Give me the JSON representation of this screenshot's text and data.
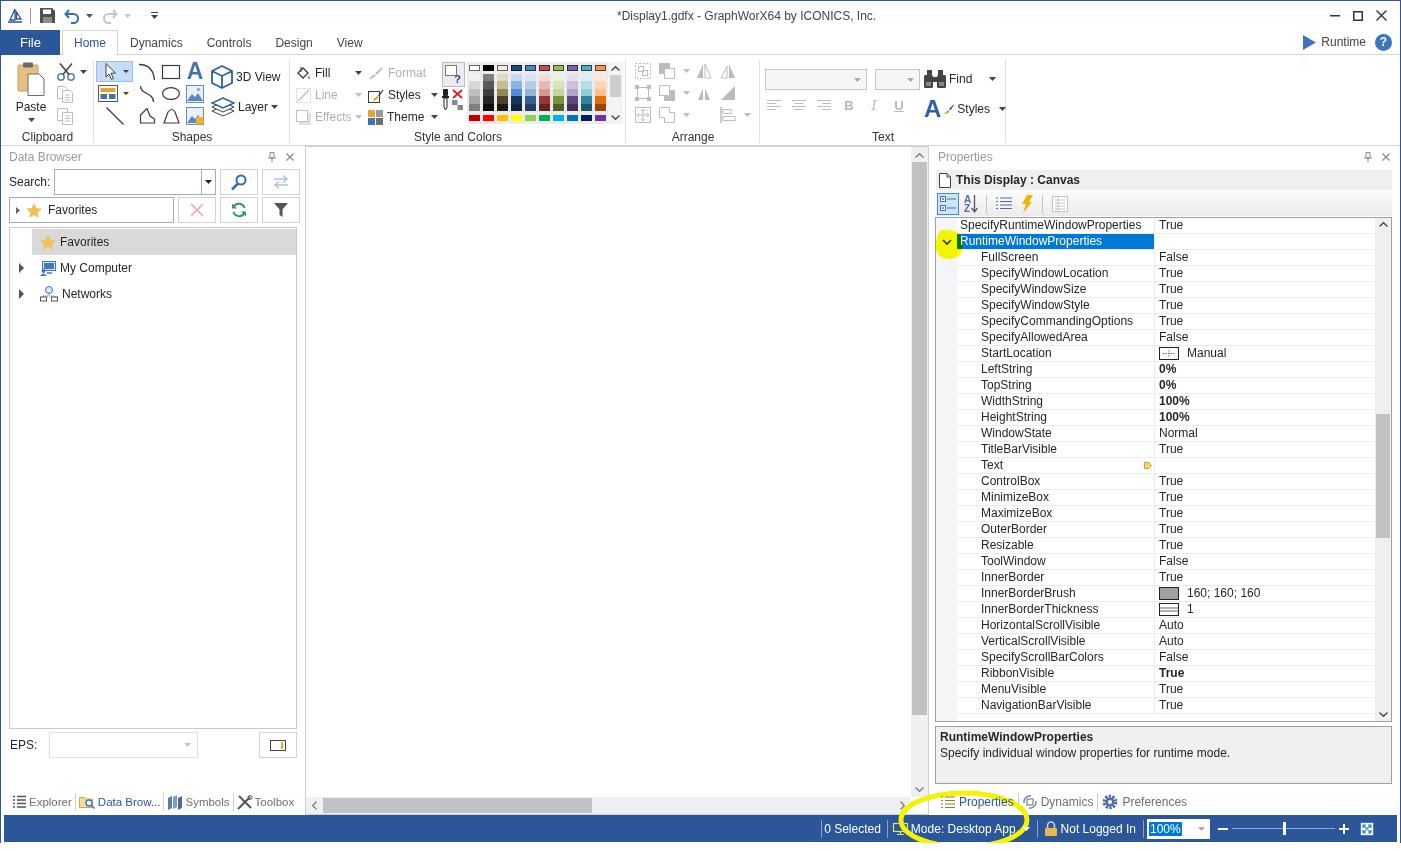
{
  "window": {
    "title": "*Display1.gdfx - GraphWorX64 by ICONICS, Inc."
  },
  "quick_access": [
    {
      "kind": "save",
      "disabled": false
    },
    {
      "kind": "undo",
      "disabled": false
    },
    {
      "kind": "redo",
      "disabled": true
    }
  ],
  "ribbon": {
    "file_tab": "File",
    "tabs": [
      {
        "label": "Home",
        "selected": true
      },
      {
        "label": "Dynamics",
        "selected": false
      },
      {
        "label": "Controls",
        "selected": false
      },
      {
        "label": "Design",
        "selected": false
      },
      {
        "label": "View",
        "selected": false
      }
    ],
    "runtime": "Runtime",
    "help": "?",
    "clipboard": {
      "label": "Clipboard",
      "paste": "Paste",
      "tools": [
        {
          "kind": "cut",
          "disabled": false
        },
        {
          "kind": "copy",
          "disabled": true
        },
        {
          "kind": "paste-copy",
          "disabled": true
        }
      ]
    },
    "shapes": {
      "label": "Shapes",
      "tools": [
        {
          "kind": "pointer",
          "selected": true
        },
        {
          "kind": "arc",
          "selected": false
        },
        {
          "kind": "rectangle",
          "selected": false
        },
        {
          "kind": "text",
          "glyph": "A",
          "selected": false
        },
        {
          "kind": "panel",
          "selected": false
        },
        {
          "kind": "curve",
          "selected": false
        },
        {
          "kind": "ellipse",
          "selected": false
        },
        {
          "kind": "image",
          "selected": false
        },
        {
          "kind": "line",
          "selected": false
        },
        {
          "kind": "polygon",
          "selected": false
        },
        {
          "kind": "shape",
          "selected": false
        },
        {
          "kind": "picture",
          "selected": false
        }
      ],
      "buttons": [
        {
          "kind": "cube",
          "label": "3D View",
          "dropdown": false
        },
        {
          "kind": "layers",
          "label": "Layer",
          "dropdown": true
        }
      ]
    },
    "style": {
      "label": "Style and Colors",
      "buttons": [
        {
          "kind": "fill",
          "label": "Fill",
          "disabled": false,
          "dropdown": true
        },
        {
          "kind": "line",
          "label": "Line",
          "disabled": true,
          "dropdown": true
        },
        {
          "kind": "effects",
          "label": "Effects",
          "disabled": true,
          "dropdown": true
        },
        {
          "kind": "format",
          "label": "Format",
          "disabled": true,
          "dropdown": false
        },
        {
          "kind": "styles",
          "label": "Styles",
          "disabled": false,
          "dropdown": true
        },
        {
          "kind": "theme",
          "label": "Theme",
          "disabled": false,
          "dropdown": true
        }
      ],
      "fill_stroke": {
        "glyph": "?"
      },
      "palette": {
        "theme_colors": [
          {
            "color": "#ffffff"
          },
          {
            "color": "#000000"
          },
          {
            "color": "#eeece1"
          },
          {
            "color": "#1f497d"
          },
          {
            "color": "#4f81bd"
          },
          {
            "color": "#c0504d"
          },
          {
            "color": "#9bbb59"
          },
          {
            "color": "#8064a2"
          },
          {
            "color": "#4bacc6"
          },
          {
            "color": "#f79646"
          }
        ],
        "shade_rows": [
          {
            "colors": [
              {
                "color": "#f2f2f2"
              },
              {
                "color": "#7f7f7f"
              },
              {
                "color": "#ddd9c3"
              },
              {
                "color": "#c6d9f0"
              },
              {
                "color": "#dbe5f1"
              },
              {
                "color": "#f2dcdb"
              },
              {
                "color": "#ebf1dd"
              },
              {
                "color": "#e5e0ec"
              },
              {
                "color": "#dbeef3"
              },
              {
                "color": "#fdeada"
              }
            ]
          },
          {
            "colors": [
              {
                "color": "#d8d8d8"
              },
              {
                "color": "#595959"
              },
              {
                "color": "#c4bd97"
              },
              {
                "color": "#8db3e2"
              },
              {
                "color": "#b8cce4"
              },
              {
                "color": "#e5b9b7"
              },
              {
                "color": "#d7e3bc"
              },
              {
                "color": "#ccc1d9"
              },
              {
                "color": "#b7dde8"
              },
              {
                "color": "#fbd5b5"
              }
            ]
          },
          {
            "colors": [
              {
                "color": "#bfbfbf"
              },
              {
                "color": "#3f3f3f"
              },
              {
                "color": "#938953"
              },
              {
                "color": "#548dd4"
              },
              {
                "color": "#95b3d7"
              },
              {
                "color": "#d99694"
              },
              {
                "color": "#c3d69b"
              },
              {
                "color": "#b2a2c7"
              },
              {
                "color": "#92cddc"
              },
              {
                "color": "#fac08f"
              }
            ]
          },
          {
            "colors": [
              {
                "color": "#a5a5a5"
              },
              {
                "color": "#262626"
              },
              {
                "color": "#494429"
              },
              {
                "color": "#17365d"
              },
              {
                "color": "#366092"
              },
              {
                "color": "#953734"
              },
              {
                "color": "#76923c"
              },
              {
                "color": "#5f497a"
              },
              {
                "color": "#31859b"
              },
              {
                "color": "#e36c09"
              }
            ]
          },
          {
            "colors": [
              {
                "color": "#7f7f7f"
              },
              {
                "color": "#0c0c0c"
              },
              {
                "color": "#1d1b10"
              },
              {
                "color": "#0f243e"
              },
              {
                "color": "#244061"
              },
              {
                "color": "#632423"
              },
              {
                "color": "#4f6128"
              },
              {
                "color": "#3f3151"
              },
              {
                "color": "#205867"
              },
              {
                "color": "#974806"
              }
            ]
          }
        ],
        "standard_colors": [
          {
            "color": "#c00000"
          },
          {
            "color": "#ff0000"
          },
          {
            "color": "#ffc000"
          },
          {
            "color": "#ffff00"
          },
          {
            "color": "#92d050"
          },
          {
            "color": "#00b050"
          },
          {
            "color": "#00b0f0"
          },
          {
            "color": "#0070c0"
          },
          {
            "color": "#002060"
          },
          {
            "color": "#7030a0"
          }
        ]
      }
    },
    "arrange": {
      "label": "Arrange",
      "tools": [
        {
          "kind": "group",
          "disabled": true,
          "dropdown": false
        },
        {
          "kind": "bring-forward",
          "disabled": true,
          "dropdown": true
        },
        {
          "kind": "flip-horizontal",
          "disabled": true,
          "dropdown": false
        },
        {
          "kind": "flip-vertical",
          "disabled": true,
          "dropdown": false
        },
        {
          "kind": "ungroup",
          "disabled": true,
          "dropdown": false
        },
        {
          "kind": "send-backward",
          "disabled": true,
          "dropdown": true
        },
        {
          "kind": "mirror",
          "disabled": true,
          "dropdown": false
        },
        {
          "kind": "rotate",
          "disabled": true,
          "dropdown": false
        },
        {
          "kind": "move",
          "disabled": true,
          "dropdown": false
        },
        {
          "kind": "combine",
          "disabled": true,
          "dropdown": true
        },
        {
          "kind": "align",
          "disabled": true,
          "dropdown": true
        }
      ]
    },
    "text": {
      "label": "Text",
      "font_field": {
        "disabled": true
      },
      "size_field": {
        "disabled": true
      },
      "tools": [
        {
          "kind": "align-left",
          "disabled": true
        },
        {
          "kind": "align-center",
          "disabled": true
        },
        {
          "kind": "align-right",
          "disabled": true
        },
        {
          "kind": "bold",
          "glyph": "B",
          "disabled": true
        },
        {
          "kind": "italic",
          "glyph": "I",
          "disabled": true
        },
        {
          "kind": "underline",
          "glyph": "U",
          "disabled": true
        }
      ],
      "buttons": [
        {
          "kind": "binoculars",
          "label": "Find",
          "dropdown": true
        },
        {
          "kind": "text-style",
          "glyph": "A",
          "label": "Styles",
          "dropdown": true
        }
      ]
    }
  },
  "data_browser": {
    "title": "Data Browser",
    "search_label": "Search:",
    "search_tools": [
      {
        "kind": "search",
        "disabled": false
      },
      {
        "kind": "swap",
        "disabled": true
      }
    ],
    "favorites_combo": "Favorites",
    "favorites_tools": [
      {
        "kind": "delete",
        "disabled": true
      },
      {
        "kind": "refresh",
        "disabled": false
      },
      {
        "kind": "filter",
        "disabled": false
      }
    ],
    "tree": [
      {
        "kind": "star",
        "label": "Favorites",
        "selected": true
      },
      {
        "kind": "computer",
        "label": "My Computer",
        "selected": false,
        "expanded": false
      },
      {
        "kind": "network",
        "label": "Networks",
        "selected": false,
        "expanded": false
      }
    ],
    "eps_label": "EPS:",
    "eps_field": {
      "disabled": true
    },
    "tabs": [
      {
        "kind": "explorer",
        "label": "Explorer",
        "selected": false
      },
      {
        "kind": "data-browser",
        "label": "Data Brow...",
        "selected": true
      },
      {
        "kind": "symbols",
        "label": "Symbols",
        "selected": false
      },
      {
        "kind": "toolbox",
        "label": "Toolbox",
        "selected": false
      }
    ]
  },
  "properties": {
    "title": "Properties",
    "object": "This Display : Canvas",
    "toolbar": [
      {
        "kind": "categorized",
        "selected": true,
        "disabled": false
      },
      {
        "kind": "alphabetical",
        "glyph": "AZ",
        "selected": false,
        "disabled": false
      },
      {
        "kind": "list",
        "selected": false,
        "disabled": false
      },
      {
        "kind": "events",
        "selected": false,
        "disabled": false
      },
      {
        "kind": "pages",
        "selected": false,
        "disabled": true
      }
    ],
    "rows": [
      {
        "name": "SpecifyRuntimeWindowProperties",
        "value": "True",
        "kind": "text",
        "selected": false,
        "modified": false
      },
      {
        "name": "RuntimeWindowProperties",
        "kind": "group",
        "selected": true,
        "expanded": true,
        "children": [
          {
            "name": "FullScreen",
            "value": "False",
            "kind": "text",
            "selected": false,
            "modified": false
          },
          {
            "name": "SpecifyWindowLocation",
            "value": "True",
            "kind": "text",
            "selected": false,
            "modified": false
          },
          {
            "name": "SpecifyWindowSize",
            "value": "True",
            "kind": "text",
            "selected": false,
            "modified": false
          },
          {
            "name": "SpecifyWindowStyle",
            "value": "True",
            "kind": "text",
            "selected": false,
            "modified": false
          },
          {
            "name": "SpecifyCommandingOptions",
            "value": "True",
            "kind": "text",
            "selected": false,
            "modified": false
          },
          {
            "name": "SpecifyAllowedArea",
            "value": "False",
            "kind": "text",
            "selected": false,
            "modified": false
          },
          {
            "name": "StartLocation",
            "value": "Manual",
            "kind": "location",
            "selected": false,
            "modified": false
          },
          {
            "name": "LeftString",
            "value": "0%",
            "kind": "text",
            "selected": false,
            "modified": true
          },
          {
            "name": "TopString",
            "value": "0%",
            "kind": "text",
            "selected": false,
            "modified": true
          },
          {
            "name": "WidthString",
            "value": "100%",
            "kind": "text",
            "selected": false,
            "modified": true
          },
          {
            "name": "HeightString",
            "value": "100%",
            "kind": "text",
            "selected": false,
            "modified": true
          },
          {
            "name": "WindowState",
            "value": "Normal",
            "kind": "text",
            "selected": false,
            "modified": false
          },
          {
            "name": "TitleBarVisible",
            "value": "True",
            "kind": "text",
            "selected": false,
            "modified": false
          },
          {
            "name": "Text",
            "kind": "tag",
            "selected": false
          },
          {
            "name": "ControlBox",
            "value": "True",
            "kind": "text",
            "selected": false,
            "modified": false
          },
          {
            "name": "MinimizeBox",
            "value": "True",
            "kind": "text",
            "selected": false,
            "modified": false
          },
          {
            "name": "MaximizeBox",
            "value": "True",
            "kind": "text",
            "selected": false,
            "modified": false
          },
          {
            "name": "OuterBorder",
            "value": "True",
            "kind": "text",
            "selected": false,
            "modified": false
          },
          {
            "name": "Resizable",
            "value": "True",
            "kind": "text",
            "selected": false,
            "modified": false
          },
          {
            "name": "ToolWindow",
            "value": "False",
            "kind": "text",
            "selected": false,
            "modified": false
          },
          {
            "name": "InnerBorder",
            "value": "True",
            "kind": "text",
            "selected": false,
            "modified": false
          },
          {
            "name": "InnerBorderBrush",
            "value": "160; 160; 160",
            "kind": "color",
            "color": "#a0a0a0",
            "selected": false,
            "modified": false
          },
          {
            "name": "InnerBorderThickness",
            "value": "1",
            "kind": "thickness",
            "selected": false,
            "modified": false
          },
          {
            "name": "HorizontalScrollVisible",
            "value": "Auto",
            "kind": "text",
            "selected": false,
            "modified": false
          },
          {
            "name": "VerticalScrollVisible",
            "value": "Auto",
            "kind": "text",
            "selected": false,
            "modified": false
          },
          {
            "name": "SpecifyScrollBarColors",
            "value": "False",
            "kind": "text",
            "selected": false,
            "modified": false
          },
          {
            "name": "RibbonVisible",
            "value": "True",
            "kind": "text",
            "selected": false,
            "modified": true
          },
          {
            "name": "MenuVisible",
            "value": "True",
            "kind": "text",
            "selected": false,
            "modified": false
          },
          {
            "name": "NavigationBarVisible",
            "value": "True",
            "kind": "text",
            "selected": false,
            "modified": false
          }
        ]
      }
    ],
    "description": {
      "title": "RuntimeWindowProperties",
      "text": "Specify individual window properties for runtime mode."
    },
    "tabs": [
      {
        "kind": "properties",
        "label": "Properties",
        "selected": true
      },
      {
        "kind": "dynamics",
        "label": "Dynamics",
        "selected": false
      },
      {
        "kind": "preferences",
        "label": "Preferences",
        "selected": false
      }
    ]
  },
  "status_bar": {
    "selection": "0 Selected",
    "mode": "Mode: Desktop App",
    "login": "Not Logged In",
    "zoom": "100%",
    "zoom_slider": {
      "level": 0.5
    }
  }
}
